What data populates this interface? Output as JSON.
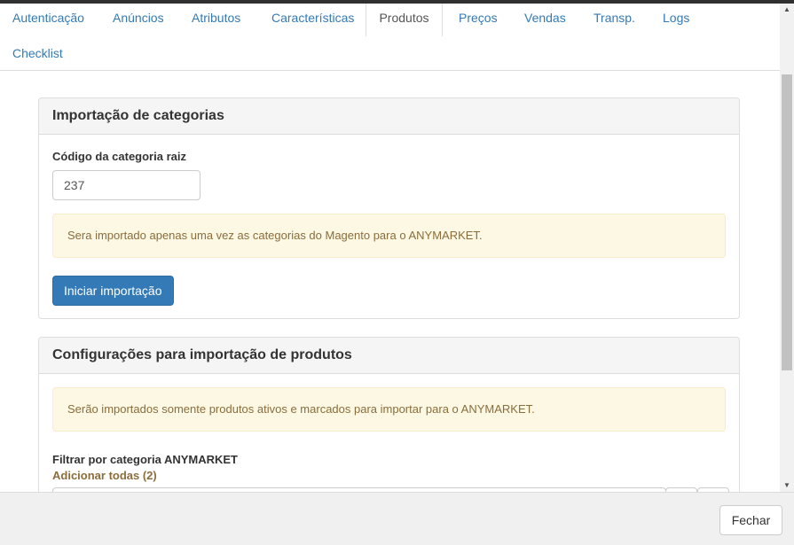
{
  "tabs": [
    {
      "label": "Autenticação"
    },
    {
      "label": "Anúncios"
    },
    {
      "label": "Atributos"
    },
    {
      "label": "Características"
    },
    {
      "label": "Produtos",
      "active": true
    },
    {
      "label": "Preços"
    },
    {
      "label": "Vendas"
    },
    {
      "label": "Transp."
    },
    {
      "label": "Logs"
    },
    {
      "label": "Checklist"
    }
  ],
  "category_import": {
    "title": "Importação de categorias",
    "root_code_label": "Código da categoria raiz",
    "root_code_value": "237",
    "warning": "Sera importado apenas uma vez as categorias do Magento para o ANYMARKET.",
    "start_button": "Iniciar importação"
  },
  "product_import": {
    "title": "Configurações para importação de produtos",
    "warning": "Serão importados somente produtos ativos e marcados para importar para o ANYMARKET.",
    "filter_label": "Filtrar por categoria ANYMARKET",
    "add_all_link": "Adicionar todas (2)"
  },
  "footer": {
    "close_button": "Fechar"
  },
  "colors": {
    "primary": "#337ab7",
    "link": "#337ab7",
    "warning_bg": "#fcf8e3",
    "warning_text": "#8a6d3b"
  },
  "icons": {
    "scroll_up": "▲",
    "scroll_down": "▼"
  }
}
